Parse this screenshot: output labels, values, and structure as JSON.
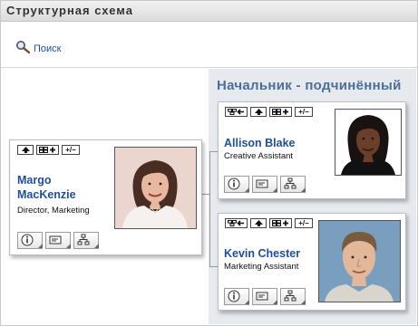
{
  "window": {
    "title": "Структурная схема"
  },
  "toolbar": {
    "search_label": "Поиск"
  },
  "section": {
    "title": "Начальник - подчинённый"
  },
  "people": {
    "manager": {
      "first_name": "Margo",
      "last_name": "MacKenzie",
      "job_title": "Director, Marketing",
      "photo_colors": {
        "bg": "#ead6cf",
        "hair": "#4a2d22",
        "skin": "#e8b9a0",
        "shirt": "#f4f1ee"
      }
    },
    "report1": {
      "name": "Allison Blake",
      "job_title": "Creative Assistant",
      "photo_colors": {
        "bg": "#ffffff",
        "hair": "#1a1210",
        "skin": "#6b3e2a",
        "shirt": "#111111"
      }
    },
    "report2": {
      "name": "Kevin Chester",
      "job_title": "Marketing Assistant",
      "photo_colors": {
        "bg": "#7a9fbe",
        "hair": "#7a5a3c",
        "skin": "#e3b89a",
        "shirt": "#d9d4cc"
      }
    }
  },
  "buttons": {
    "expand_collapse": "+/−"
  },
  "icons": [
    "search-icon",
    "goto-manager-icon",
    "up-arrow-icon",
    "org-chart-icon",
    "info-icon",
    "email-icon",
    "hierarchy-icon"
  ],
  "colors": {
    "link": "#1f4f9c",
    "section_title": "#4a6f98",
    "section_bg": "#e6e9ee"
  }
}
